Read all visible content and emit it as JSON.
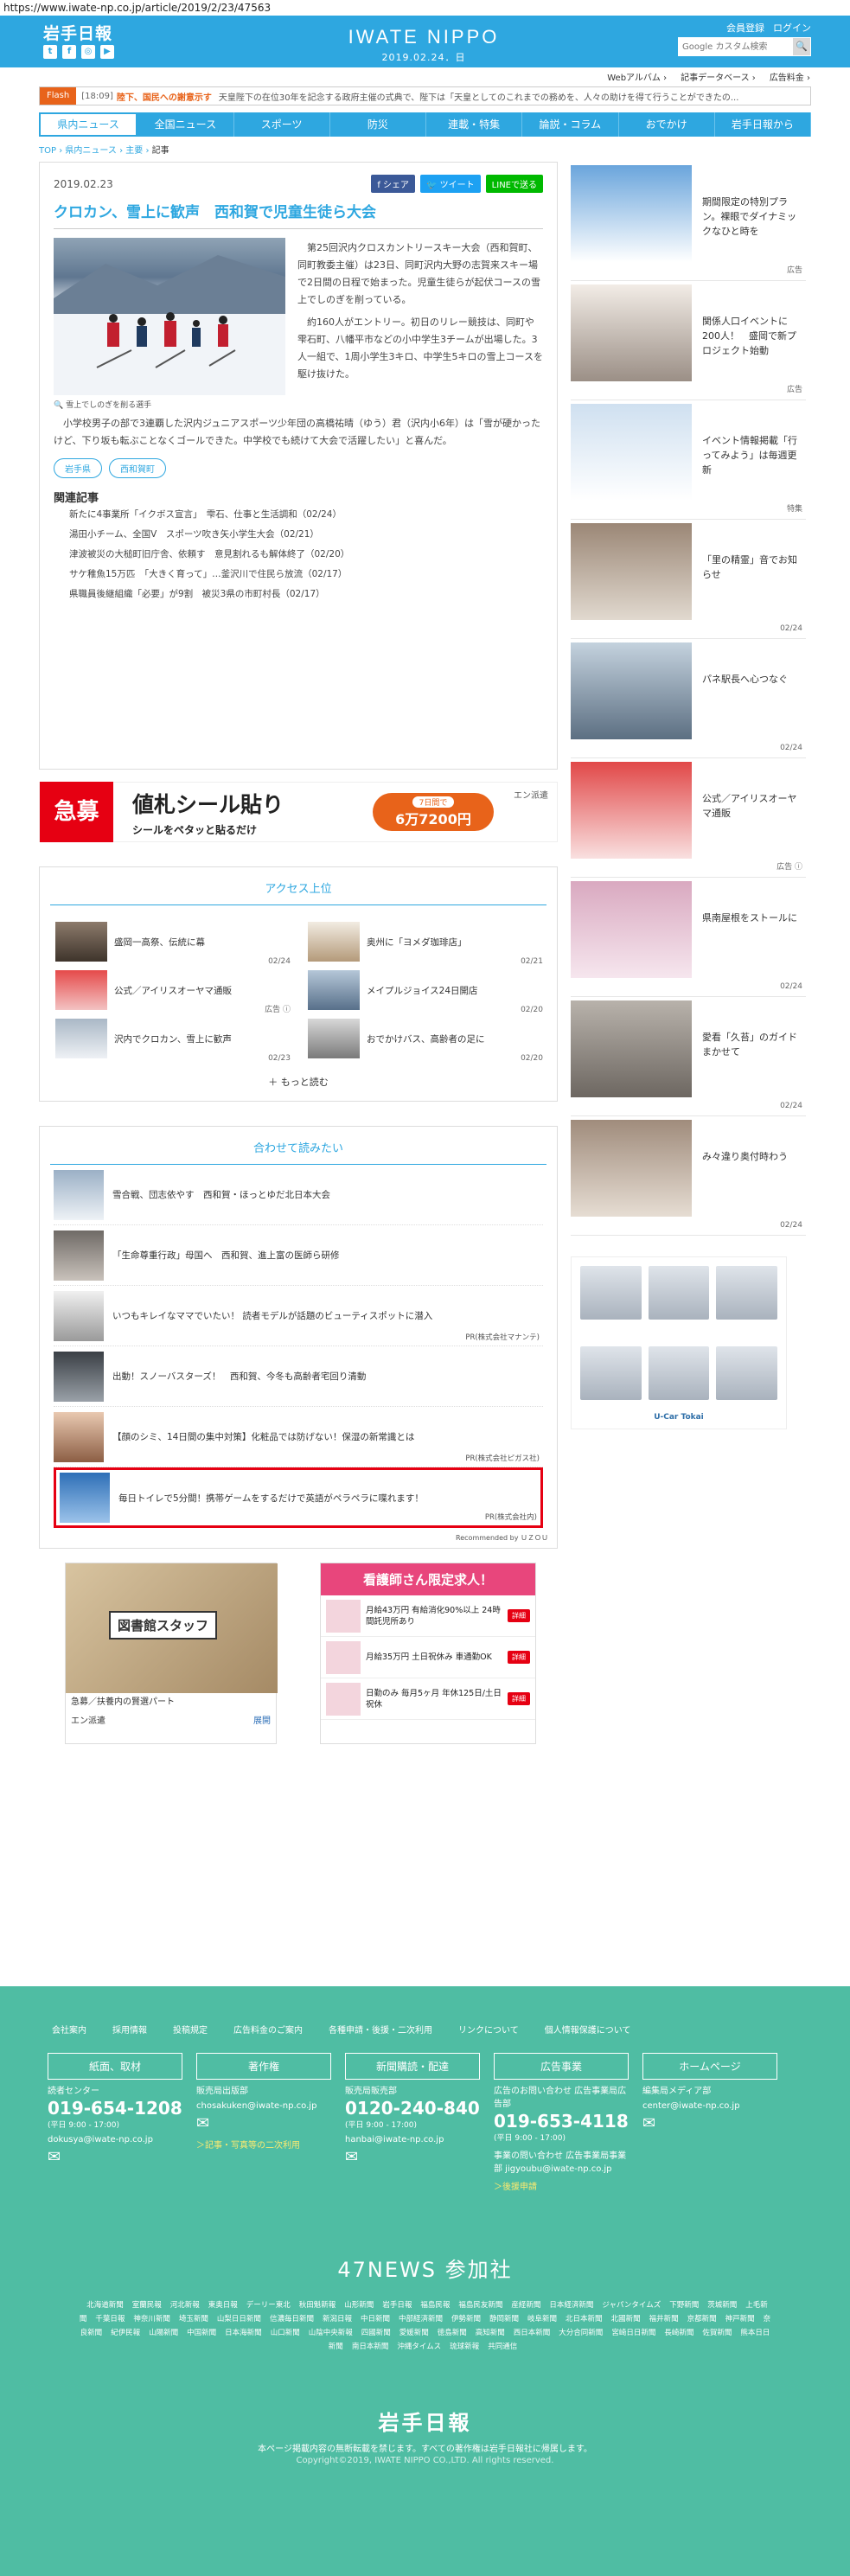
{
  "browser": {
    "url": "https://www.iwate-np.co.jp/article/2019/2/23/47563"
  },
  "header": {
    "logo": "岩手日報",
    "brand": "IWATE NIPPO",
    "date": "2019.02.24．日",
    "register": "会員登録",
    "login": "ログイン",
    "search_placeholder": "Google カスタム検索",
    "search_btn": "🔍",
    "social": [
      "t",
      "f",
      "◎",
      "▶"
    ]
  },
  "utility": [
    "Webアルバム ›",
    "記事データベース ›",
    "広告料金 ›"
  ],
  "flash": {
    "tag": "Flash",
    "time": "[18:09]",
    "headline": "陸下、国民への謝意示す",
    "text": "天皇陛下の在位30年を記念する政府主催の式典で、陛下は「天皇としてのこれまでの務めを、人々の助けを得て行うことができたの..."
  },
  "nav": [
    "県内ニュース",
    "全国ニュース",
    "スポーツ",
    "防災",
    "連載・特集",
    "論説・コラム",
    "おでかけ",
    "岩手日報から"
  ],
  "breadcrumb": {
    "top": "TOP",
    "sep1": "›",
    "cat": "県内ニュース",
    "sep2": "›",
    "sub": "主要",
    "sep3": "›",
    "current": "記事"
  },
  "article": {
    "date": "2019.02.23",
    "share": [
      "f シェア",
      "🐦 ツイート",
      "LINEで送る"
    ],
    "title": "クロカン、雪上に歓声　西和賀で児童生徒ら大会",
    "photo_caption": "🔍 雪上でしのぎを削る選手",
    "paragraphs": [
      "第25回沢内クロスカントリースキー大会（西和賀町、同町教委主催）は23日、同町沢内大野の志賀来スキー場で2日間の日程で始まった。児童生徒らが起伏コースの雪上でしのぎを削っている。",
      "約160人がエントリー。初日のリレー競技は、同町や雫石町、八幡平市などの小中学生3チームが出場した。3人一組で、1周小学生3キロ、中学生5キロの雪上コースを駆け抜けた。",
      "小学校男子の部で3連覇した沢内ジュニアスポーツ少年団の高橋祐晴（ゆう）君（沢内小6年）は「雪が硬かったけど、下り坂も転ぶことなくゴールできた。中学校でも続けて大会で活躍したい」と喜んだ。"
    ],
    "tags": [
      "岩手県",
      "西和賀町"
    ],
    "related_heading": "関連記事",
    "related": [
      "新たに4事業所「イクボス宣言」　雫石、仕事と生活調和（02/24）",
      "湯田小チーム、全国V　スポーツ吹き矢小学生大会（02/21）",
      "津波被災の大槌町旧庁舎、依頼す　意見割れるも解体終了（02/20）",
      "サケ稚魚15万匹　「大きく育って」…釜沢川で住民ら放流（02/17）",
      "県職員後継組織「必要」が9割　被災3県の市町村長（02/17）"
    ]
  },
  "banner_ad": {
    "red": "急募",
    "t1": "値札シール貼り",
    "t2": "シールをペタッと貼るだけ",
    "pill_small": "7日間で",
    "pill_big": "6万7200円",
    "brand": "エン派遣"
  },
  "access": {
    "heading": "アクセス上位",
    "items": [
      {
        "title": "盛岡一高祭、伝統に幕",
        "date": "02/24"
      },
      {
        "title": "奥州に「ヨメダ珈琲店」",
        "date": "02/21"
      },
      {
        "title": "公式／アイリスオーヤマ通販",
        "date": "広告 ⓘ"
      },
      {
        "title": "メイプルジョイス24日開店",
        "date": "02/20"
      },
      {
        "title": "沢内でクロカン、雪上に歓声",
        "date": "02/23"
      },
      {
        "title": "おでかけバス、高齢者の足に",
        "date": "02/20"
      }
    ],
    "more": "もっと読む"
  },
  "recommend": {
    "heading": "合わせて読みたい",
    "items": [
      {
        "title": "雪合戦、団志依やす　西和賀・ほっとゆだ北日本大会",
        "pr": ""
      },
      {
        "title": "「生命尊重行政」母国へ　西和賀、進上富の医師ら研修",
        "pr": ""
      },
      {
        "title": "いつもキレイなママでいたい！ 読者モデルが話題のビューティスポットに潜入",
        "pr": "PR(株式会社マナンテ)"
      },
      {
        "title": "出動！スノーバスターズ！　西和賀、今冬も高齢者宅回り清動",
        "pr": ""
      },
      {
        "title": "【顔のシミ、14日間の集中対策】化粧品では防げない！保湿の新常識とは",
        "pr": "PR(株式会社ピガス社)"
      },
      {
        "title": "毎日トイレで5分間！携帯ゲームをするだけで英語がペラペラに喋れます！",
        "pr": "PR(株式会社内)"
      }
    ],
    "powered": "Recommended by ＵＺＯＵ"
  },
  "ad_a": {
    "sign": "図書館スタッフ",
    "text": "急募／扶養内の賢選パート",
    "brand": "エン派遣",
    "cta": "展開"
  },
  "ad_b": {
    "heading": "看護師さん限定求人！",
    "rows": [
      {
        "text": "月給43万円 有給消化90%以上 24時間託児所あり",
        "btn": "詳細"
      },
      {
        "text": "月給35万円 土日祝休み 車通勤OK",
        "btn": "詳細"
      },
      {
        "text": "日勤のみ 毎月5ヶ月 年休125日/土日祝休",
        "btn": "詳細"
      }
    ]
  },
  "sidebar": {
    "items": [
      {
        "title": "期間限定の特別プラン。裸眼でダイナミックなひと時を",
        "date": "広告"
      },
      {
        "title": "関係人口イベントに200人！　盛岡で新プロジェクト始動",
        "date": "広告"
      },
      {
        "title": "イベント情報掲載「行ってみよう」は毎週更新",
        "date": "特集"
      },
      {
        "title": "「里の精霊」音でお知らせ",
        "date": "02/24"
      },
      {
        "title": "パネ駅長へ心つなぐ",
        "date": "02/24"
      },
      {
        "title": "公式／アイリスオーヤマ通販",
        "date": "広告 ⓘ"
      },
      {
        "title": "県南屋根をストールに",
        "date": "02/24"
      },
      {
        "title": "愛看「久苔」のガイドまかせて",
        "date": "02/24"
      },
      {
        "title": "み々違り奥付時わう",
        "date": "02/24"
      }
    ],
    "car_ad_brand": "U-Car Tokai"
  },
  "footer": {
    "links": [
      "会社案内",
      "採用情報",
      "投稿規定",
      "広告料金のご案内",
      "各種申請・後援・二次利用",
      "リンクについて",
      "個人情報保護について"
    ],
    "cols": [
      {
        "head": "紙面、取材",
        "label": "読者センター",
        "phone": "019-654-1208",
        "hours": "(平日 9:00 - 17:00)",
        "email": "dokusya@iwate-np.co.jp",
        "link": ""
      },
      {
        "head": "著作権",
        "label": "販売局出版部",
        "phone": "",
        "hours": "",
        "email": "chosakuken@iwate-np.co.jp",
        "link": "＞記事・写真等の二次利用"
      },
      {
        "head": "新聞購読・配達",
        "label": "販売局販売部",
        "phone": "0120-240-840",
        "hours": "(平日 9:00 - 17:00)",
        "email": "hanbai@iwate-np.co.jp",
        "link": ""
      },
      {
        "head": "広告事業",
        "label": "広告のお問い合わせ 広告事業局広告部",
        "phone": "019-653-4118",
        "hours": "(平日 9:00 - 17:00)",
        "email": "事業の問い合わせ 広告事業局事業部 jigyoubu@iwate-np.co.jp",
        "link": "＞後援申請"
      },
      {
        "head": "ホームページ",
        "label": "編集局メディア部",
        "phone": "",
        "hours": "",
        "email": "center@iwate-np.co.jp",
        "link": ""
      }
    ],
    "n47": "47NEWS 参加社",
    "papers": [
      "北海道新聞",
      "室蘭民報",
      "河北新報",
      "東奥日報",
      "デーリー東北",
      "秋田魁新報",
      "山形新聞",
      "岩手日報",
      "福島民報",
      "福島民友新聞",
      "産経新聞",
      "日本経済新聞",
      "ジャパンタイムズ",
      "下野新聞",
      "茨城新聞",
      "上毛新聞",
      "千葉日報",
      "神奈川新聞",
      "埼玉新聞",
      "山梨日日新聞",
      "信濃毎日新聞",
      "新潟日報",
      "中日新聞",
      "中部経済新聞",
      "伊勢新聞",
      "静岡新聞",
      "岐阜新聞",
      "北日本新聞",
      "北國新聞",
      "福井新聞",
      "京都新聞",
      "神戸新聞",
      "奈良新聞",
      "紀伊民報",
      "山陽新聞",
      "中国新聞",
      "日本海新聞",
      "山口新聞",
      "山陰中央新報",
      "四國新聞",
      "愛媛新聞",
      "徳島新聞",
      "高知新聞",
      "西日本新聞",
      "大分合同新聞",
      "宮崎日日新聞",
      "長崎新聞",
      "佐賀新聞",
      "熊本日日新聞",
      "南日本新聞",
      "沖縄タイムス",
      "琉球新報",
      "共同通信"
    ],
    "logo": "岩手日報",
    "note": "本ページ掲載内容の無断転載を禁じます。すべての著作権は岩手日報社に帰属します。",
    "copy": "Copyright©2019, IWATE NIPPO CO.,LTD. All rights reserved."
  }
}
